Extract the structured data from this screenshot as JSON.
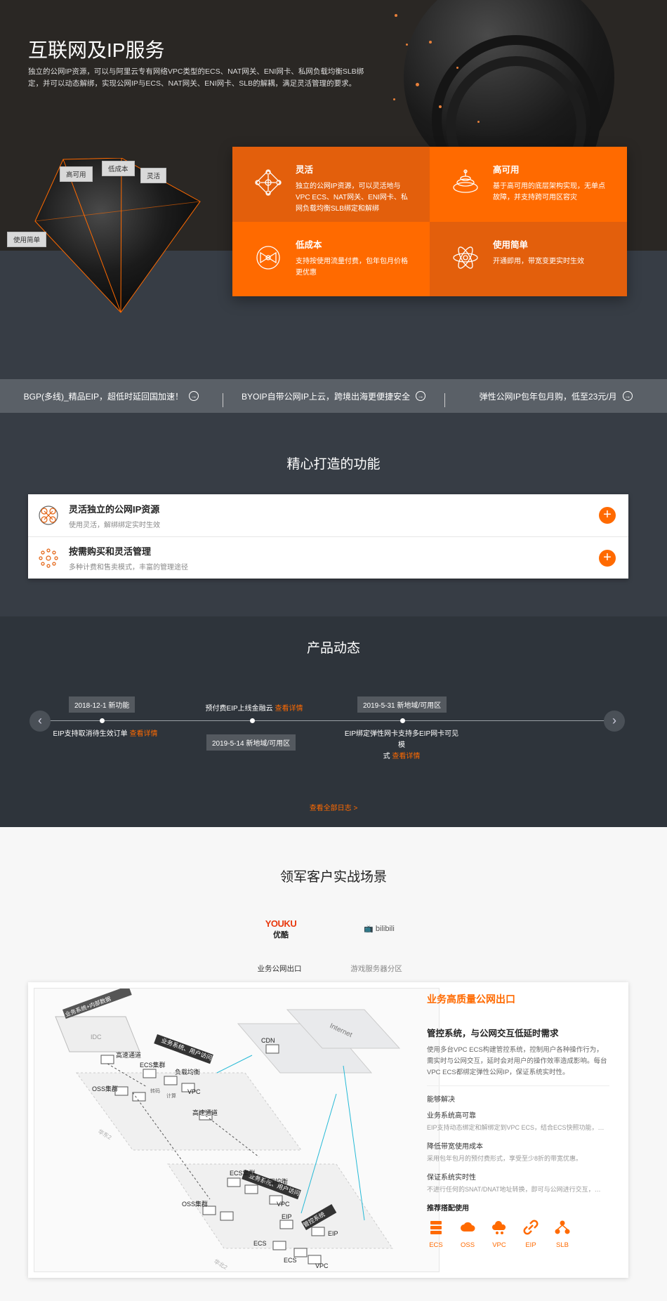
{
  "hero": {
    "title": "互联网及IP服务",
    "desc": "独立的公网IP资源，可以与阿里云专有网络VPC类型的ECS、NAT网关、ENI网卡、私网负载均衡SLB绑定，并可以动态解绑，实现公网IP与ECS、NAT网关、ENI网卡、SLB的解耦，满足灵活管理的要求。",
    "tags": {
      "high_avail": "高可用",
      "low_cost": "低成本",
      "flexible": "灵活",
      "easy": "使用简单"
    },
    "features": [
      {
        "title": "灵活",
        "desc": "独立的公网IP资源，可以灵活地与VPC ECS、NAT网关、ENI网卡、私网负载均衡SLB绑定和解绑",
        "icon": "network-icon"
      },
      {
        "title": "高可用",
        "desc": "基于高可用的底层架构实现，无单点故障，并支持跨可用区容灾",
        "icon": "layers-icon"
      },
      {
        "title": "低成本",
        "desc": "支持按使用流量付费，包年包月价格更优惠",
        "icon": "cost-icon"
      },
      {
        "title": "使用简单",
        "desc": "开通即用，带宽变更实时生效",
        "icon": "atom-icon"
      }
    ]
  },
  "strip": [
    {
      "text": "BGP(多线)_精品EIP，超低时延回国加速！"
    },
    {
      "text": "BYOIP自带公网IP上云，跨境出海更便捷安全"
    },
    {
      "text": "弹性公网IP包年包月购，低至23元/月"
    }
  ],
  "caps": {
    "title": "精心打造的功能",
    "items": [
      {
        "title": "灵活独立的公网IP资源",
        "desc": "使用灵活，解绑绑定实时生效"
      },
      {
        "title": "按需购买和灵活管理",
        "desc": "多种计费和售卖模式，丰富的管理途径"
      }
    ]
  },
  "news": {
    "title": "产品动态",
    "more": "查看详情",
    "all": "查看全部日志 >",
    "events": [
      {
        "date": "2018-12-1  新功能",
        "text": "EIP支持取消待生效订单"
      },
      {
        "date": "2019-5-14  新地域/可用区",
        "text": "预付费EIP上线金融云"
      },
      {
        "date": "2019-5-31  新地域/可用区",
        "text_line1": "EIP绑定弹性网卡支持多EIP网卡可见模",
        "text_line2": "式"
      }
    ]
  },
  "customers": {
    "title": "领军客户实战场景",
    "brands": [
      {
        "logo_en": "YOUKU",
        "logo_cn": "优酷",
        "tab": "业务公网出口"
      },
      {
        "logo_en": "bilibili",
        "tab": "游戏服务器分区"
      }
    ],
    "scene": {
      "heading": "业务高质量公网出口",
      "subtitle": "管控系统，与公网交互低延时需求",
      "desc": "使用多台VPC ECS构建管控系统，控制用户各种操作行为，需实时与公网交互，延时会对用户的操作效率造成影响。每台VPC ECS都绑定弹性公网IP，保证系统实时性。",
      "solve_label": "能够解决",
      "benefits": [
        {
          "title": "业务系统高可靠",
          "text": "EIP支持动态绑定和解绑定到VPC ECS，结合ECS快照功能，实..."
        },
        {
          "title": "降低带宽使用成本",
          "text": "采用包年包月的预付费形式，享受至少8折的带宽优惠。"
        },
        {
          "title": "保证系统实时性",
          "text": "不进行任何的SNAT/DNAT地址转换，即可与公网进行交互，保证..."
        }
      ],
      "rec_label": "推荐搭配使用",
      "products": [
        "ECS",
        "OSS",
        "VPC",
        "EIP",
        "SLB"
      ],
      "diagram": {
        "idc": "IDC",
        "biz1": "业务系统+内部数据",
        "fast": "高速通道",
        "ecs_cluster": "ECS集群",
        "slb": "负载均衡",
        "vpc": "VPC",
        "oss_cluster": "OSS集群",
        "transfer": "转码",
        "compute": "计算",
        "user_access": "业务系统、用户访问",
        "cdn": "CDN",
        "internet": "Internet",
        "region1": "华东2",
        "region2": "华北2",
        "control": "管控系统",
        "eip": "EIP",
        "ecs": "ECS"
      }
    }
  }
}
